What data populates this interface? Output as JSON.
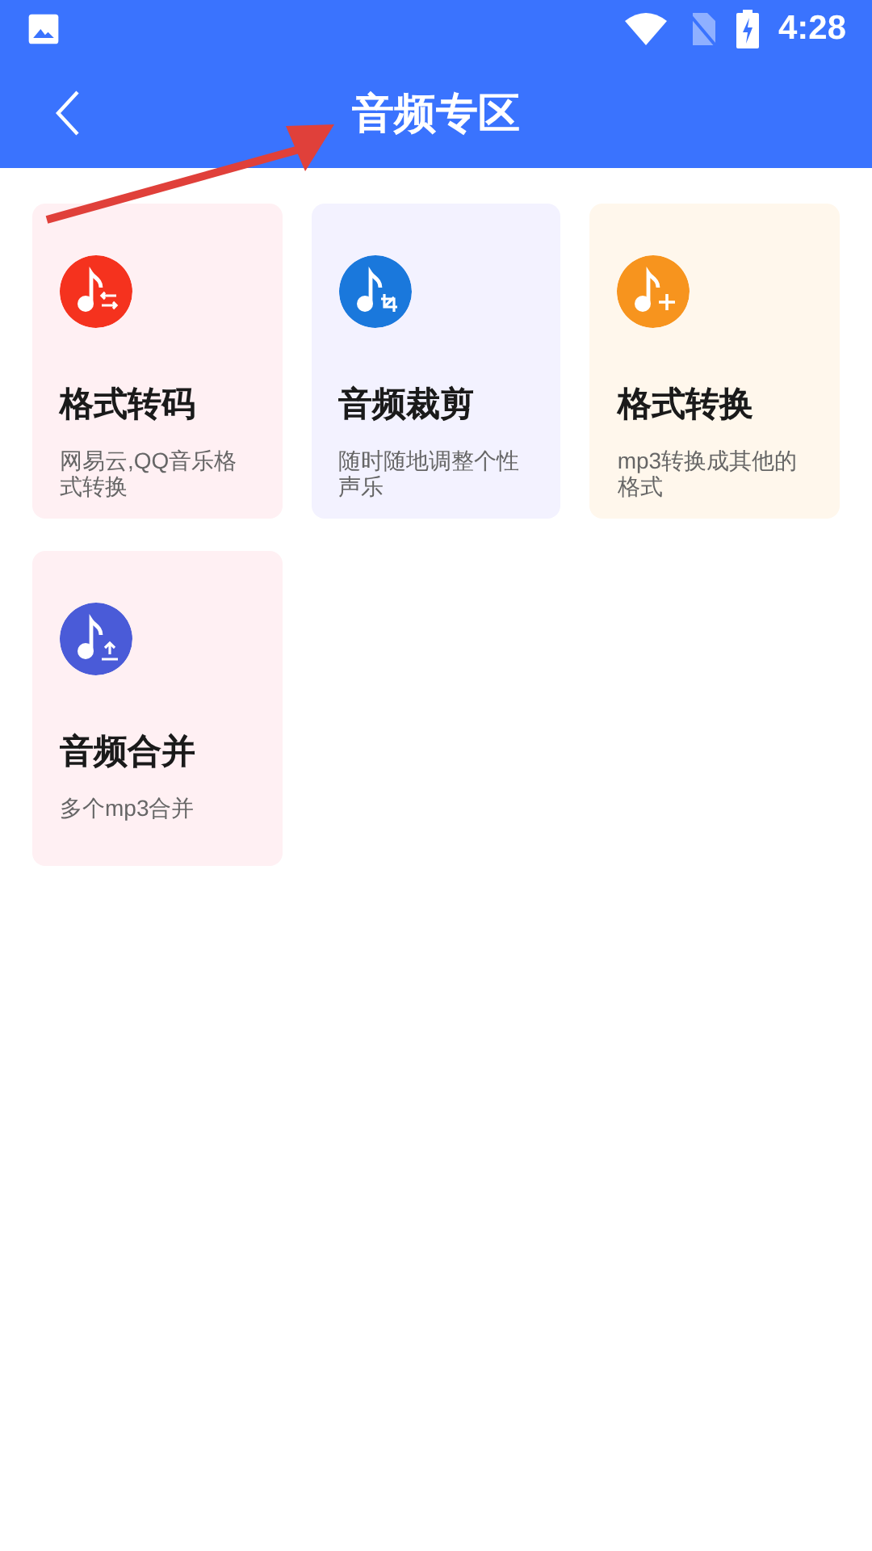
{
  "status_bar": {
    "time": "4:28"
  },
  "header": {
    "title": "音频专区"
  },
  "tools": [
    {
      "kind": "swap",
      "color": "#f5321e",
      "title": "格式转码",
      "description": "网易云,QQ音乐格式转换"
    },
    {
      "kind": "crop",
      "color": "#1a78dc",
      "title": "音频裁剪",
      "description": "随时随地调整个性声乐"
    },
    {
      "kind": "plus",
      "color": "#f7941e",
      "title": "格式转换",
      "description": "mp3转换成其他的格式"
    },
    {
      "kind": "upload",
      "color": "#4a5bd8",
      "title": "音频合并",
      "description": "多个mp3合并"
    }
  ]
}
